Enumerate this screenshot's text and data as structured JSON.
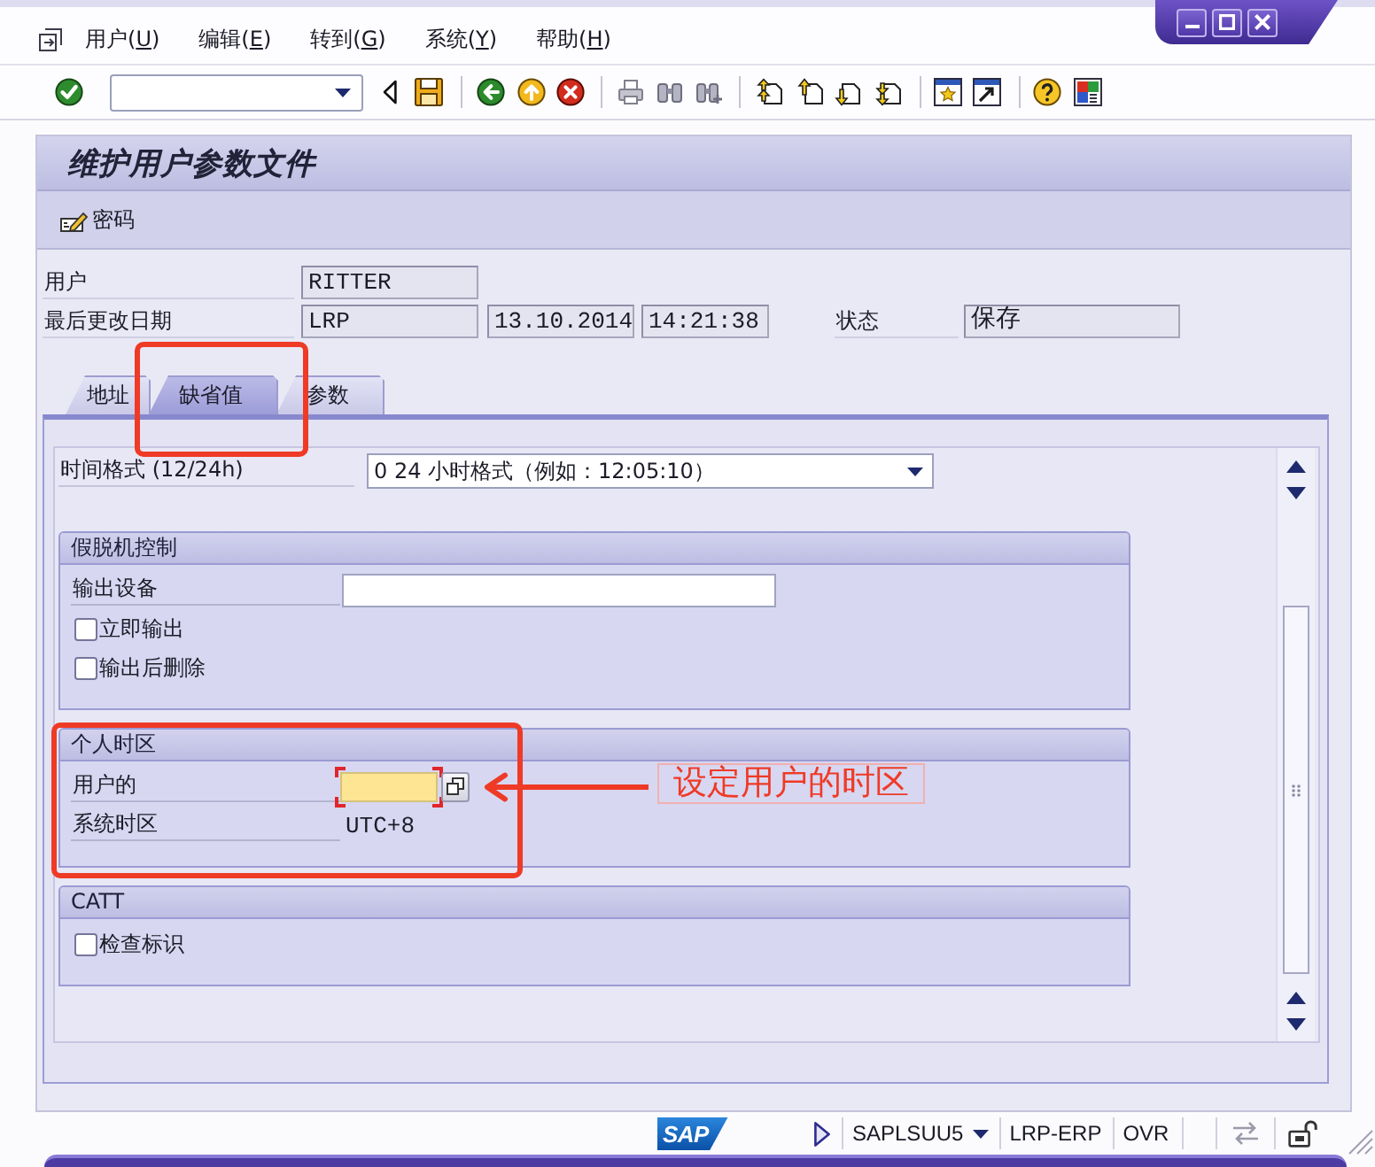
{
  "menu": {
    "items": [
      "用户(U)",
      "编辑(E)",
      "转到(G)",
      "系统(Y)",
      "帮助(H)"
    ]
  },
  "screen": {
    "title": "维护用户参数文件",
    "toolbar_buttons": [
      {
        "label": "密码"
      }
    ]
  },
  "header": {
    "rows": [
      {
        "label": "用户",
        "values": [
          "RITTER"
        ]
      },
      {
        "label": "最后更改日期",
        "values": [
          "LRP",
          "13.10.2014",
          "14:21:38"
        ]
      }
    ],
    "status": {
      "label": "状态",
      "value": "保存"
    }
  },
  "tabs": [
    {
      "label": "地址",
      "selected": false
    },
    {
      "label": "缺省值",
      "selected": true
    },
    {
      "label": "参数",
      "selected": false
    }
  ],
  "tab_content": {
    "time_format": {
      "label": "时间格式 (12/24h)",
      "value": "0 24 小时格式（例如：12:05:10）"
    },
    "groups": [
      {
        "title": "假脱机控制",
        "rows": [
          {
            "kind": "input",
            "label": "输出设备",
            "focused": false
          },
          {
            "kind": "checkbox",
            "label": "立即输出",
            "checked": false
          },
          {
            "kind": "checkbox",
            "label": "输出后删除",
            "checked": false
          }
        ]
      },
      {
        "title": "个人时区",
        "rows": [
          {
            "kind": "value_help",
            "label": "用户的",
            "focused": true
          },
          {
            "kind": "display",
            "label": "系统时区",
            "value": "UTC+8"
          }
        ]
      },
      {
        "title": "CATT",
        "rows": [
          {
            "kind": "checkbox",
            "label": "检查标识",
            "checked": false
          }
        ]
      }
    ]
  },
  "annotation": {
    "text": "设定用户的时区"
  },
  "status_bar": {
    "logo": "SAP",
    "program": "SAPLSUU5",
    "system": "LRP-ERP",
    "mode": "OVR"
  }
}
